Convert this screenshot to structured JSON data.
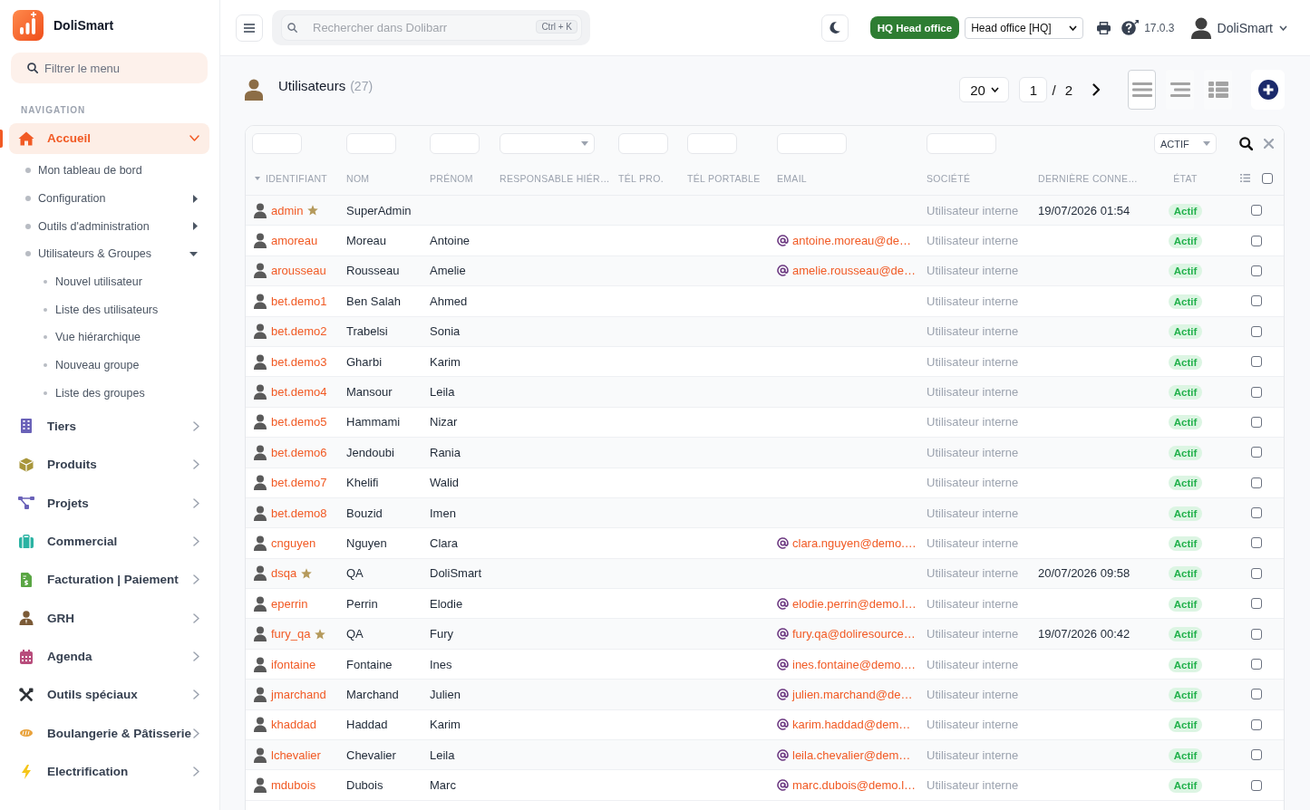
{
  "sidebar": {
    "brand": "DoliSmart",
    "filter": {
      "placeholder": "Filtrer le menu"
    },
    "section": "NAVIGATION",
    "items": [
      {
        "label": "Accueil",
        "selected": true,
        "expanded": true,
        "children": [
          {
            "label": "Mon tableau de bord",
            "kind": "link"
          },
          {
            "label": "Configuration",
            "kind": "group",
            "expanded": false
          },
          {
            "label": "Outils d'administration",
            "kind": "group",
            "expanded": false
          },
          {
            "label": "Utilisateurs & Groupes",
            "kind": "group",
            "expanded": true,
            "children": [
              {
                "label": "Nouvel utilisateur"
              },
              {
                "label": "Liste des utilisateurs"
              },
              {
                "label": "Vue hiérarchique"
              },
              {
                "label": "Nouveau groupe"
              },
              {
                "label": "Liste des groupes"
              }
            ]
          }
        ]
      },
      {
        "label": "Tiers",
        "selected": false,
        "expanded": false
      },
      {
        "label": "Produits",
        "selected": false,
        "expanded": false
      },
      {
        "label": "Projets",
        "selected": false,
        "expanded": false
      },
      {
        "label": "Commercial",
        "selected": false,
        "expanded": false
      },
      {
        "label": "Facturation | Paiement",
        "selected": false,
        "expanded": false
      },
      {
        "label": "GRH",
        "selected": false,
        "expanded": false
      },
      {
        "label": "Agenda",
        "selected": false,
        "expanded": false
      },
      {
        "label": "Outils spéciaux",
        "selected": false,
        "expanded": false
      },
      {
        "label": "Boulangerie & Pâtisserie",
        "selected": false,
        "expanded": false
      },
      {
        "label": "Electrification",
        "selected": false,
        "expanded": false
      }
    ]
  },
  "topbar": {
    "search": {
      "placeholder": "Rechercher dans Dolibarr",
      "shortcut": "Ctrl + K"
    },
    "entity_badge": "HQ Head office",
    "entity_select": "Head office [HQ]",
    "version": "17.0.3",
    "user": "DoliSmart"
  },
  "page": {
    "title": "Utilisateurs",
    "count": "(27)",
    "pagination": {
      "page_size": "20",
      "page": "1",
      "separator": "/",
      "pages": "2"
    },
    "view_modes": [
      {
        "kind": "list",
        "selected": true
      },
      {
        "kind": "compact",
        "selected": false
      },
      {
        "kind": "grid",
        "selected": false
      }
    ]
  },
  "table": {
    "columns": [
      {
        "label": "IDENTIFIANT",
        "sorted": true,
        "kind": "input"
      },
      {
        "label": "NOM",
        "sorted": false,
        "kind": "input"
      },
      {
        "label": "PRÉNOM",
        "sorted": false,
        "kind": "input"
      },
      {
        "label": "RESPONSABLE HIÉR…",
        "sorted": false,
        "kind": "select"
      },
      {
        "label": "TÉL PRO.",
        "sorted": false,
        "kind": "input"
      },
      {
        "label": "TÉL PORTABLE",
        "sorted": false,
        "kind": "input"
      },
      {
        "label": "EMAIL",
        "sorted": false,
        "kind": "input"
      },
      {
        "label": "SOCIÉTÉ",
        "sorted": false,
        "kind": "input"
      },
      {
        "label": "DERNIÈRE CONNE…",
        "sorted": false,
        "kind": "plain"
      },
      {
        "label": "ÉTAT",
        "sorted": false,
        "kind": "select",
        "filter_value": "ACTIF"
      }
    ],
    "select_all": {
      "checked": false
    },
    "rows": [
      {
        "login": "admin",
        "admin": true,
        "last_name": "SuperAdmin",
        "company": "Utilisateur interne",
        "last_login": "19/07/2026 01:54",
        "status": "Actif",
        "selected": false
      },
      {
        "login": "amoreau",
        "admin": false,
        "last_name": "Moreau",
        "first_name": "Antoine",
        "email": "antoine.moreau@de…",
        "company": "Utilisateur interne",
        "status": "Actif",
        "selected": false
      },
      {
        "login": "arousseau",
        "admin": false,
        "last_name": "Rousseau",
        "first_name": "Amelie",
        "email": "amelie.rousseau@de…",
        "company": "Utilisateur interne",
        "status": "Actif",
        "selected": false
      },
      {
        "login": "bet.demo1",
        "admin": false,
        "last_name": "Ben Salah",
        "first_name": "Ahmed",
        "company": "Utilisateur interne",
        "status": "Actif",
        "selected": false
      },
      {
        "login": "bet.demo2",
        "admin": false,
        "last_name": "Trabelsi",
        "first_name": "Sonia",
        "company": "Utilisateur interne",
        "status": "Actif",
        "selected": false
      },
      {
        "login": "bet.demo3",
        "admin": false,
        "last_name": "Gharbi",
        "first_name": "Karim",
        "company": "Utilisateur interne",
        "status": "Actif",
        "selected": false
      },
      {
        "login": "bet.demo4",
        "admin": false,
        "last_name": "Mansour",
        "first_name": "Leila",
        "company": "Utilisateur interne",
        "status": "Actif",
        "selected": false
      },
      {
        "login": "bet.demo5",
        "admin": false,
        "last_name": "Hammami",
        "first_name": "Nizar",
        "company": "Utilisateur interne",
        "status": "Actif",
        "selected": false
      },
      {
        "login": "bet.demo6",
        "admin": false,
        "last_name": "Jendoubi",
        "first_name": "Rania",
        "company": "Utilisateur interne",
        "status": "Actif",
        "selected": false
      },
      {
        "login": "bet.demo7",
        "admin": false,
        "last_name": "Khelifi",
        "first_name": "Walid",
        "company": "Utilisateur interne",
        "status": "Actif",
        "selected": false
      },
      {
        "login": "bet.demo8",
        "admin": false,
        "last_name": "Bouzid",
        "first_name": "Imen",
        "company": "Utilisateur interne",
        "status": "Actif",
        "selected": false
      },
      {
        "login": "cnguyen",
        "admin": false,
        "last_name": "Nguyen",
        "first_name": "Clara",
        "email": "clara.nguyen@demo.…",
        "company": "Utilisateur interne",
        "status": "Actif",
        "selected": false
      },
      {
        "login": "dsqa",
        "admin": true,
        "last_name": "QA",
        "first_name": "DoliSmart",
        "company": "Utilisateur interne",
        "last_login": "20/07/2026 09:58",
        "status": "Actif",
        "selected": false
      },
      {
        "login": "eperrin",
        "admin": false,
        "last_name": "Perrin",
        "first_name": "Elodie",
        "email": "elodie.perrin@demo.l…",
        "company": "Utilisateur interne",
        "status": "Actif",
        "selected": false
      },
      {
        "login": "fury_qa",
        "admin": true,
        "last_name": "QA",
        "first_name": "Fury",
        "email": "fury.qa@doliresource…",
        "company": "Utilisateur interne",
        "last_login": "19/07/2026 00:42",
        "status": "Actif",
        "selected": false
      },
      {
        "login": "ifontaine",
        "admin": false,
        "last_name": "Fontaine",
        "first_name": "Ines",
        "email": "ines.fontaine@demo.…",
        "company": "Utilisateur interne",
        "status": "Actif",
        "selected": false
      },
      {
        "login": "jmarchand",
        "admin": false,
        "last_name": "Marchand",
        "first_name": "Julien",
        "email": "julien.marchand@de…",
        "company": "Utilisateur interne",
        "status": "Actif",
        "selected": false
      },
      {
        "login": "khaddad",
        "admin": false,
        "last_name": "Haddad",
        "first_name": "Karim",
        "email": "karim.haddad@dem…",
        "company": "Utilisateur interne",
        "status": "Actif",
        "selected": false
      },
      {
        "login": "lchevalier",
        "admin": false,
        "last_name": "Chevalier",
        "first_name": "Leila",
        "email": "leila.chevalier@dem…",
        "company": "Utilisateur interne",
        "status": "Actif",
        "selected": false
      },
      {
        "login": "mdubois",
        "admin": false,
        "last_name": "Dubois",
        "first_name": "Marc",
        "email": "marc.dubois@demo.l…",
        "company": "Utilisateur interne",
        "status": "Actif",
        "selected": false
      }
    ]
  }
}
